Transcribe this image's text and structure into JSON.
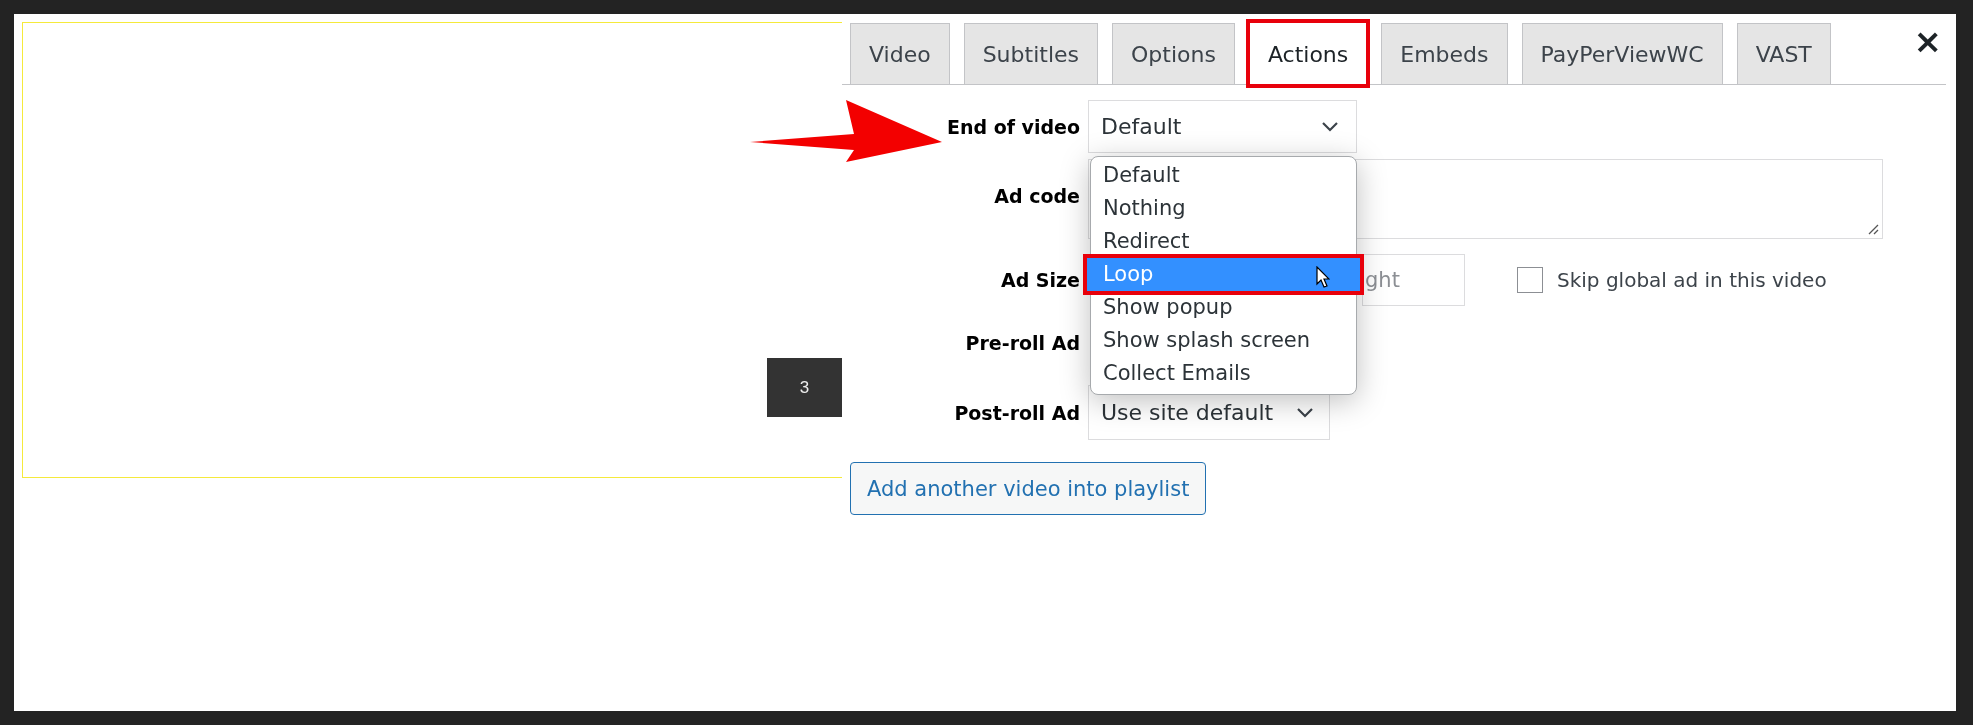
{
  "preview": {
    "badge": "3"
  },
  "close": "×",
  "tabs": [
    {
      "label": "Video",
      "selected": false,
      "annotated": false
    },
    {
      "label": "Subtitles",
      "selected": false,
      "annotated": false
    },
    {
      "label": "Options",
      "selected": false,
      "annotated": false
    },
    {
      "label": "Actions",
      "selected": true,
      "annotated": true
    },
    {
      "label": "Embeds",
      "selected": false,
      "annotated": false
    },
    {
      "label": "PayPerViewWC",
      "selected": false,
      "annotated": false
    },
    {
      "label": "VAST",
      "selected": false,
      "annotated": false
    }
  ],
  "end_of_video": {
    "label": "End of video",
    "value": "Default",
    "expanded": true,
    "options": [
      {
        "label": "Default",
        "highlighted": false,
        "annotated": false
      },
      {
        "label": "Nothing",
        "highlighted": false,
        "annotated": false
      },
      {
        "label": "Redirect",
        "highlighted": false,
        "annotated": false
      },
      {
        "label": "Loop",
        "highlighted": true,
        "annotated": true
      },
      {
        "label": "Show popup",
        "highlighted": false,
        "annotated": false
      },
      {
        "label": "Show splash screen",
        "highlighted": false,
        "annotated": false
      },
      {
        "label": "Collect Emails",
        "highlighted": false,
        "annotated": false
      }
    ]
  },
  "ad_code": {
    "label": "Ad code"
  },
  "ad_size": {
    "label": "Ad Size",
    "height_placeholder": "ght",
    "skip_global_ad": {
      "label": "Skip global ad in this video",
      "checked": false
    }
  },
  "pre_roll": {
    "label": "Pre-roll Ad"
  },
  "post_roll": {
    "label": "Post-roll Ad",
    "value": "Use site default"
  },
  "add_button": "Add another video into playlist"
}
